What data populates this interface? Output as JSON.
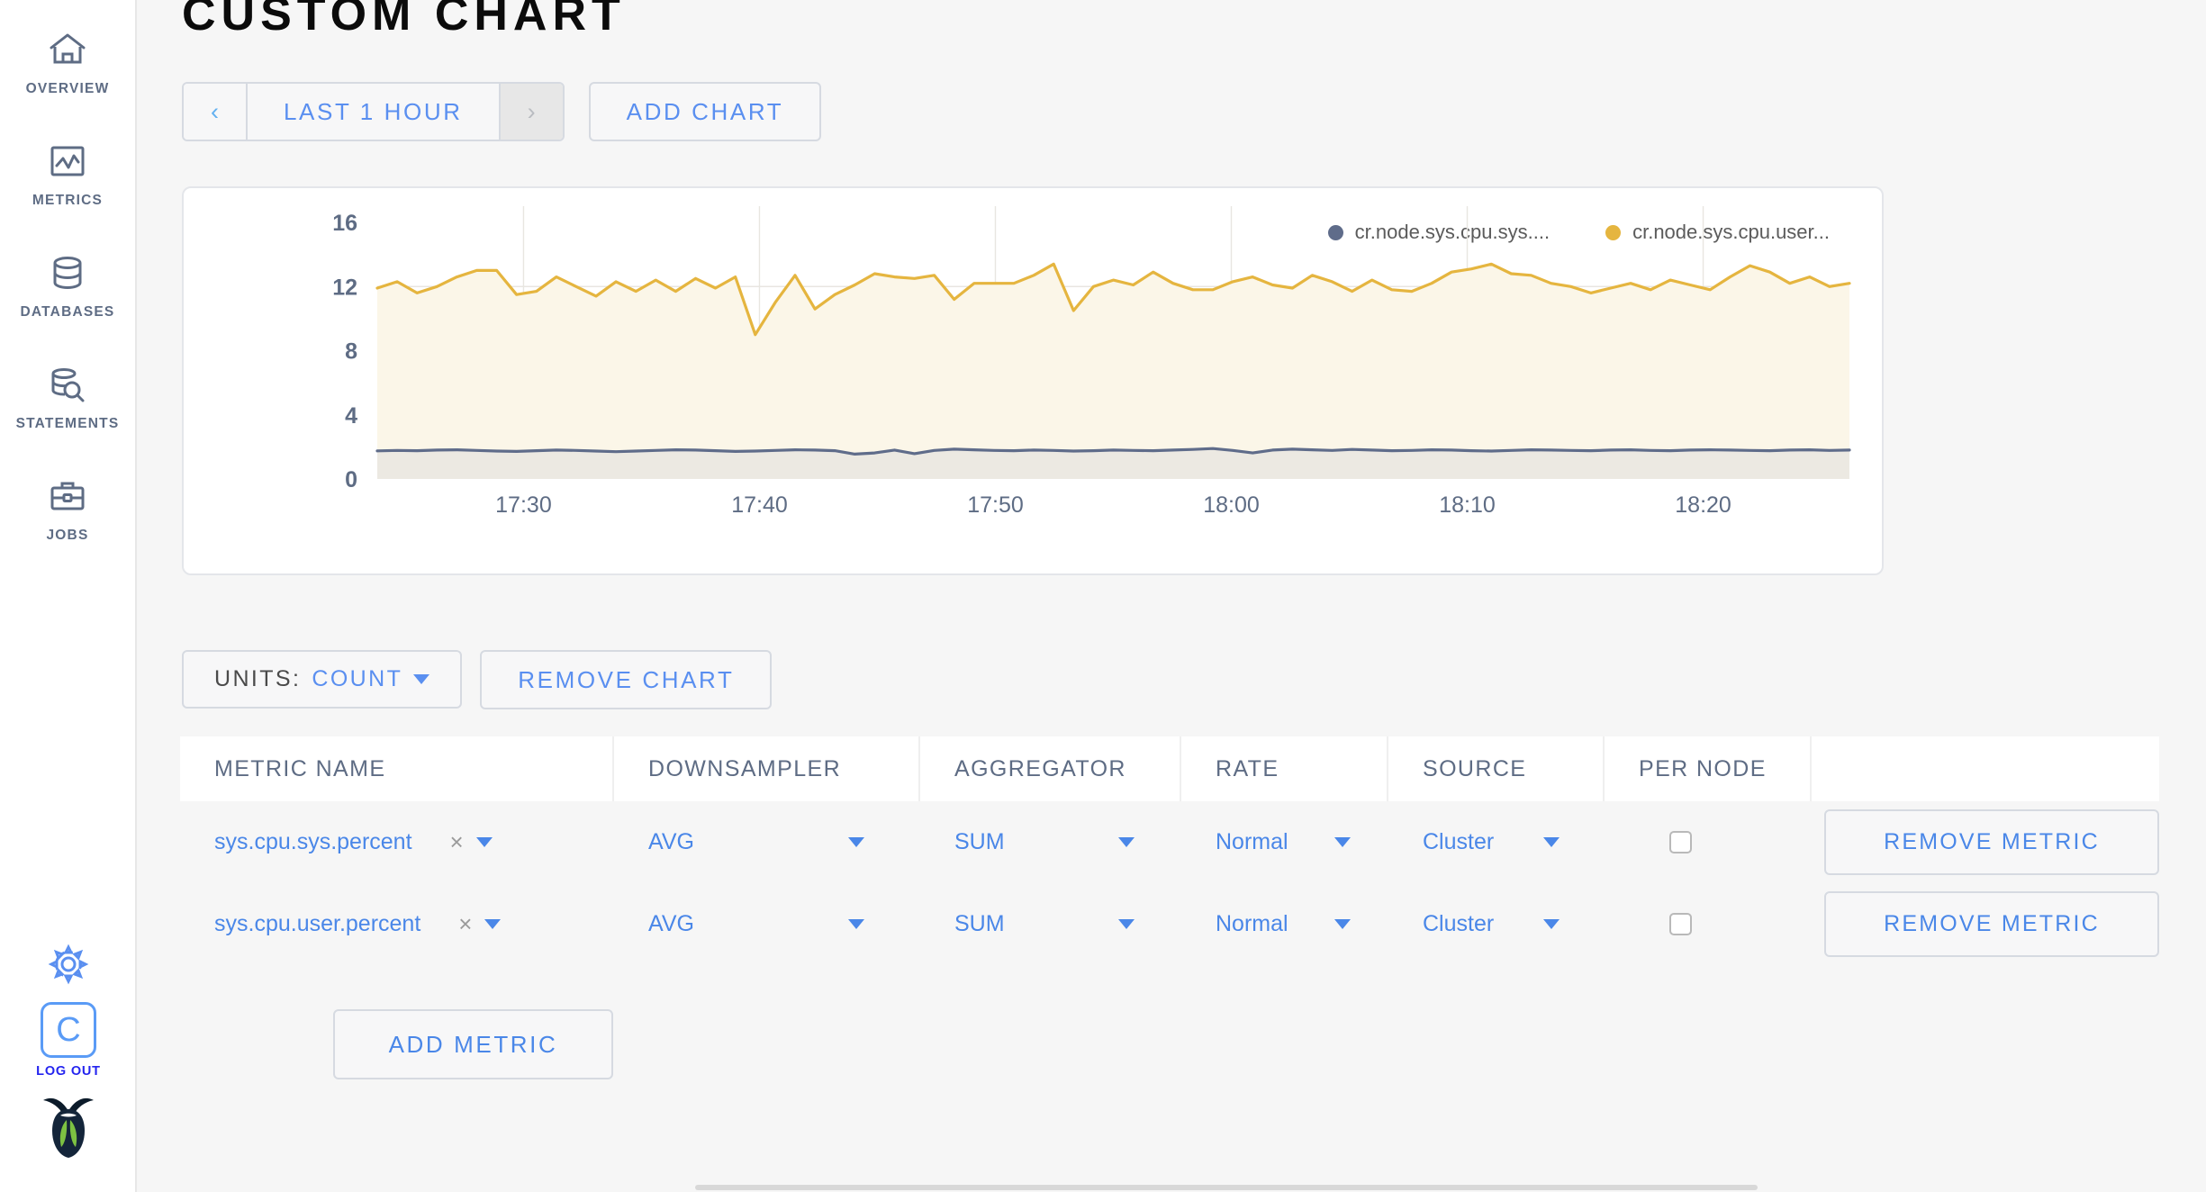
{
  "sidebar": {
    "items": [
      {
        "label": "Overview",
        "icon": "home-icon",
        "key": "overview"
      },
      {
        "label": "Metrics",
        "icon": "metrics-chart-icon",
        "key": "metrics"
      },
      {
        "label": "Databases",
        "icon": "database-icon",
        "key": "databases"
      },
      {
        "label": "Statements",
        "icon": "database-search-icon",
        "key": "statements"
      },
      {
        "label": "Jobs",
        "icon": "briefcase-icon",
        "key": "jobs"
      }
    ],
    "settings_icon": "gear-icon",
    "logout": {
      "glyph": "C",
      "label": "LOG OUT"
    },
    "brand_icon": "cockroach-logo-icon",
    "colors": {
      "icon": "#5e6c84",
      "logout_border": "#5a9bf6",
      "logout_label": "#2424ef"
    }
  },
  "header": {
    "title": "Custom Chart"
  },
  "toolbar": {
    "prev_label": "‹",
    "time_range": "LAST 1 HOUR",
    "next_label": "›",
    "add_chart": "ADD CHART"
  },
  "chart_controls": {
    "units_label": "UNITS:",
    "units_value": "COUNT",
    "remove_chart": "REMOVE CHART"
  },
  "table": {
    "headers": [
      "Metric Name",
      "Downsampler",
      "Aggregator",
      "Rate",
      "Source",
      "Per Node",
      ""
    ],
    "rows": [
      {
        "metric_name": "sys.cpu.sys.percent",
        "clear": "×",
        "downsampler": "AVG",
        "aggregator": "SUM",
        "rate": "Normal",
        "source": "Cluster",
        "per_node": false,
        "action": "REMOVE METRIC"
      },
      {
        "metric_name": "sys.cpu.user.percent",
        "clear": "×",
        "downsampler": "AVG",
        "aggregator": "SUM",
        "rate": "Normal",
        "source": "Cluster",
        "per_node": false,
        "action": "REMOVE METRIC"
      }
    ],
    "add_metric": "ADD METRIC"
  },
  "chart_data": {
    "type": "area",
    "title": "",
    "xlabel": "",
    "ylabel": "",
    "grid": true,
    "legend_position": "top-right",
    "ylim": [
      0,
      16
    ],
    "yticks": [
      0,
      4,
      8,
      12,
      16
    ],
    "xticks": [
      "17:30",
      "17:40",
      "17:50",
      "18:00",
      "18:10",
      "18:20"
    ],
    "x_start": "17:26",
    "x_end": "18:26",
    "colors": {
      "cpu_sys": "#5f6c8a",
      "cpu_user": "#e5b53f",
      "cpu_sys_fill": "#ece9e2",
      "cpu_user_fill": "#fbf6e8"
    },
    "series": [
      {
        "name": "cr.node.sys.cpu.sys....",
        "color": "#5f6c8a",
        "values": [
          1.75,
          1.78,
          1.76,
          1.8,
          1.82,
          1.78,
          1.74,
          1.72,
          1.76,
          1.8,
          1.78,
          1.74,
          1.7,
          1.74,
          1.78,
          1.82,
          1.8,
          1.76,
          1.72,
          1.74,
          1.78,
          1.82,
          1.8,
          1.76,
          1.55,
          1.62,
          1.8,
          1.58,
          1.78,
          1.86,
          1.82,
          1.78,
          1.76,
          1.8,
          1.78,
          1.74,
          1.76,
          1.8,
          1.78,
          1.76,
          1.8,
          1.84,
          1.9,
          1.78,
          1.62,
          1.8,
          1.86,
          1.82,
          1.78,
          1.84,
          1.8,
          1.76,
          1.78,
          1.82,
          1.8,
          1.76,
          1.74,
          1.78,
          1.82,
          1.8,
          1.78,
          1.76,
          1.8,
          1.82,
          1.78,
          1.76,
          1.8,
          1.82,
          1.8,
          1.78,
          1.76,
          1.8,
          1.82,
          1.78,
          1.8
        ]
      },
      {
        "name": "cr.node.sys.cpu.user...",
        "color": "#e5b53f",
        "values": [
          11.9,
          12.3,
          11.6,
          12.0,
          12.6,
          13.0,
          13.0,
          11.5,
          11.7,
          12.6,
          12.0,
          11.4,
          12.3,
          11.7,
          12.4,
          11.7,
          12.5,
          11.9,
          12.6,
          9.0,
          11.0,
          12.7,
          10.6,
          11.5,
          12.1,
          12.8,
          12.6,
          12.5,
          12.7,
          11.2,
          12.2,
          12.2,
          12.2,
          12.7,
          13.4,
          10.5,
          12.0,
          12.4,
          12.1,
          12.9,
          12.2,
          11.8,
          11.8,
          12.3,
          12.6,
          12.1,
          11.9,
          12.7,
          12.3,
          11.7,
          12.4,
          11.8,
          11.7,
          12.2,
          12.9,
          13.1,
          13.4,
          12.8,
          12.7,
          12.2,
          12.0,
          11.6,
          11.9,
          12.2,
          11.8,
          12.4,
          12.1,
          11.8,
          12.6,
          13.3,
          12.9,
          12.2,
          12.6,
          12.0,
          12.2
        ]
      }
    ]
  }
}
